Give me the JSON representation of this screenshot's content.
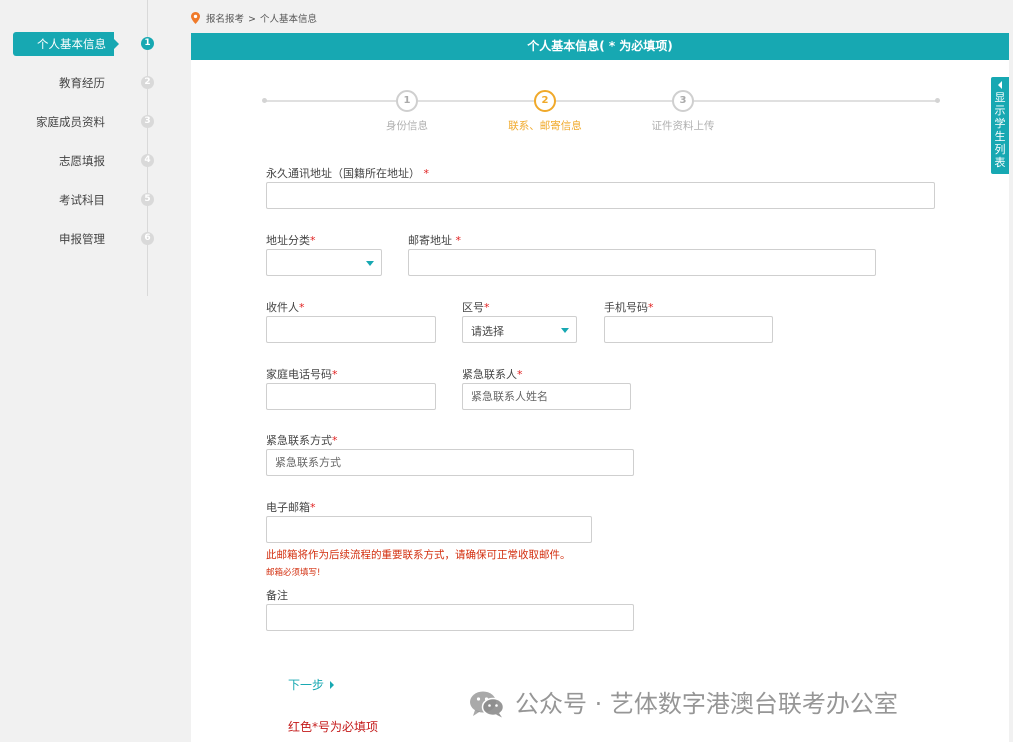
{
  "colors": {
    "accent": "#17a8b2",
    "step_active": "#f0a92a",
    "required": "#e02020",
    "warning": "#d32f0f"
  },
  "sidebar": {
    "items": [
      {
        "label": "个人基本信息",
        "num": "1",
        "active": true
      },
      {
        "label": "教育经历",
        "num": "2"
      },
      {
        "label": "家庭成员资料",
        "num": "3"
      },
      {
        "label": "志愿填报",
        "num": "4"
      },
      {
        "label": "考试科目",
        "num": "5"
      },
      {
        "label": "申报管理",
        "num": "6"
      }
    ]
  },
  "breadcrumb": {
    "icon": "location-pin-icon",
    "parent": "报名报考",
    "separator": ">",
    "current": "个人基本信息"
  },
  "panel": {
    "title": "个人基本信息( * 为必填项)"
  },
  "side_tab": {
    "label": "显示学生列表"
  },
  "stepper": {
    "steps": [
      {
        "num": "1",
        "label": "身份信息"
      },
      {
        "num": "2",
        "label": "联系、邮寄信息",
        "active": true
      },
      {
        "num": "3",
        "label": "证件资料上传"
      }
    ]
  },
  "form": {
    "permanent_address": {
      "label": "永久通讯地址（国籍所在地址）",
      "required": "*",
      "value": ""
    },
    "address_type": {
      "label": "地址分类",
      "required": "*",
      "selected": ""
    },
    "mailing_address": {
      "label": "邮寄地址",
      "required": "*",
      "value": ""
    },
    "recipient": {
      "label": "收件人",
      "required": "*",
      "value": ""
    },
    "area_code": {
      "label": "区号",
      "required": "*",
      "selected": "请选择"
    },
    "mobile": {
      "label": "手机号码",
      "required": "*",
      "value": ""
    },
    "home_phone": {
      "label": "家庭电话号码",
      "required": "*",
      "value": ""
    },
    "emergency_contact": {
      "label": "紧急联系人",
      "required": "*",
      "placeholder": "紧急联系人姓名"
    },
    "emergency_method": {
      "label": "紧急联系方式",
      "required": "*",
      "placeholder": "紧急联系方式"
    },
    "email": {
      "label": "电子邮箱",
      "required": "*",
      "value": "",
      "notice": "此邮箱将作为后续流程的重要联系方式，请确保可正常收取邮件。",
      "error": "邮箱必须填写!"
    },
    "remarks": {
      "label": "备注",
      "value": ""
    }
  },
  "actions": {
    "next_label": "下一步"
  },
  "footnote": "红色*号为必填项",
  "watermark": {
    "icon": "wechat-icon",
    "text": "公众号 · 艺体数字港澳台联考办公室"
  }
}
